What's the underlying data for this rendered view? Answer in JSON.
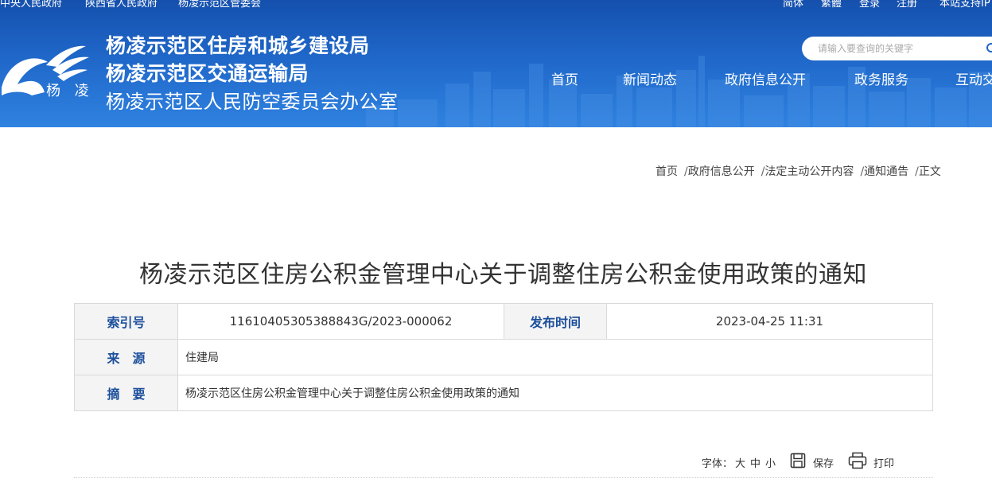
{
  "top_links": {
    "left": [
      "中央人民政府",
      "陕西省人民政府",
      "杨凌示范区管委会"
    ],
    "right": [
      "简体",
      "繁體",
      "登录",
      "注册",
      "本站支持IP"
    ]
  },
  "logo": {
    "text": "杨 凌"
  },
  "org_names": [
    "杨凌示范区住房和城乡建设局",
    "杨凌示范区交通运输局",
    "杨凌示范区人民防空委员会办公室"
  ],
  "search": {
    "placeholder": "请输入要查询的关键字"
  },
  "nav": [
    "首页",
    "新闻动态",
    "政府信息公开",
    "政务服务",
    "互动交流"
  ],
  "breadcrumb": [
    "首页",
    "政府信息公开",
    "法定主动公开内容",
    "通知通告",
    "正文"
  ],
  "article": {
    "title": "杨凌示范区住房公积金管理中心关于调整住房公积金使用政策的通知"
  },
  "info_table": {
    "index_label": "索引号",
    "index_value": "11610405305388843G/2023-000062",
    "publish_label": "发布时间",
    "publish_value": "2023-04-25 11:31",
    "source_label": "来　源",
    "source_value": "住建局",
    "summary_label": "摘　要",
    "summary_value": "杨凌示范区住房公积金管理中心关于调整住房公积金使用政策的通知"
  },
  "tools": {
    "font_label": "字体：",
    "size_large": "大",
    "size_medium": "中",
    "size_small": "小",
    "save_label": "保存",
    "print_label": "打印"
  },
  "colors": {
    "header_top": "#1550ad",
    "header_bottom": "#2f82e0",
    "label_blue": "#1c4f9c",
    "label_bg": "#f4f4f4"
  }
}
